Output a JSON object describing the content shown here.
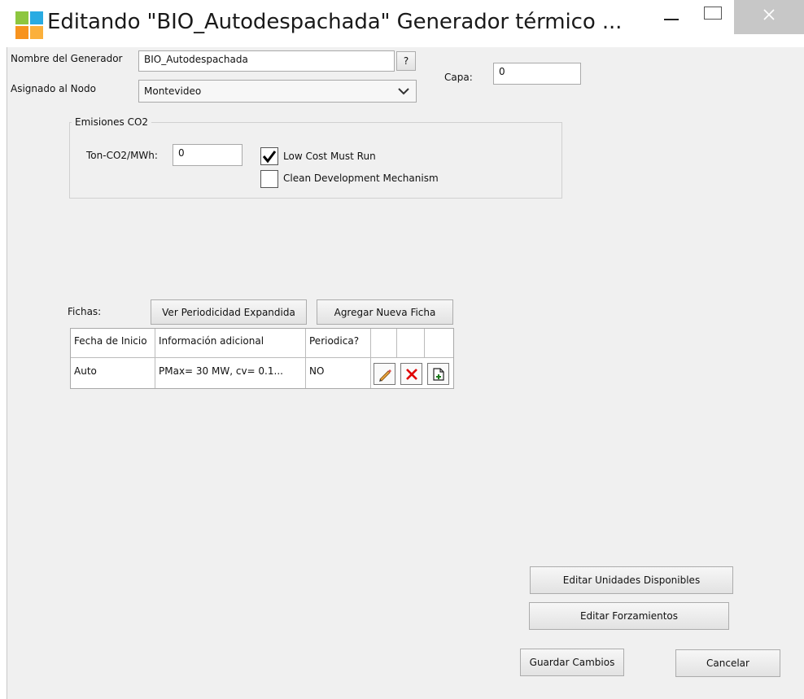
{
  "window": {
    "title": "Editando \"BIO_Autodespachada\" Generador térmico ...",
    "icon": "app-grid-icon"
  },
  "form": {
    "nombre_label": "Nombre del Generador",
    "nombre_value": "BIO_Autodespachada",
    "help_label": "?",
    "nodo_label": "Asignado al Nodo",
    "nodo_value": "Montevideo",
    "capa_label": "Capa:",
    "capa_value": "0"
  },
  "emisiones": {
    "title": "Emisiones CO2",
    "ton_label": "Ton-CO2/MWh:",
    "ton_value": "0",
    "low_cost_label": "Low Cost Must Run",
    "low_cost_checked": true,
    "cdm_label": "Clean Development Mechanism",
    "cdm_checked": false
  },
  "fichas": {
    "label": "Fichas:",
    "ver_periodicidad_button": "Ver Periodicidad Expandida",
    "agregar_button": "Agregar Nueva Ficha",
    "columns": [
      "Fecha de Inicio",
      "Información adicional",
      "Periodica?",
      "",
      "",
      ""
    ],
    "rows": [
      {
        "fecha": "Auto",
        "info": "PMax= 30 MW, cv= 0.1...",
        "periodica": "NO",
        "actions": [
          "edit-pencil-icon",
          "delete-x-icon",
          "clone-document-icon"
        ]
      }
    ]
  },
  "actions": {
    "editar_unidades": "Editar Unidades Disponibles",
    "editar_forzamientos": "Editar Forzamientos",
    "guardar": "Guardar Cambios",
    "cancelar": "Cancelar"
  },
  "colors": {
    "client_bg": "#f0f0f0",
    "close_button_bg": "#c7c7c7",
    "icon_green": "#8dc63f",
    "icon_blue": "#29abe2",
    "icon_orange": "#f7931e",
    "icon_yellow": "#fbb03b",
    "delete_red": "#e00000"
  }
}
